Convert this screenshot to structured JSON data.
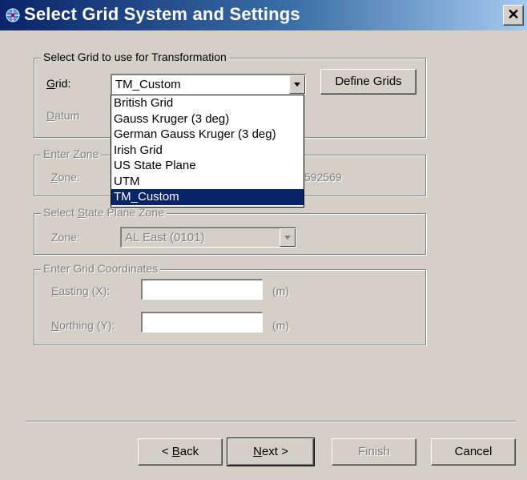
{
  "window": {
    "title": "Select Grid System and Settings",
    "close_glyph": "✕"
  },
  "grid_group": {
    "title": "Select Grid to use for Transformation",
    "grid_label_underline": "G",
    "grid_label_rest": "rid:",
    "grid_value": "TM_Custom",
    "define_grids_label": "Define Grids",
    "datum_label_underline": "D",
    "datum_label_rest": "atum"
  },
  "dropdown": {
    "items": [
      "British Grid",
      "Gauss Kruger (3 deg)",
      "German Gauss Kruger (3 deg)",
      "Irish Grid",
      "US State Plane",
      "UTM",
      "TM_Custom"
    ],
    "selected_index": 6
  },
  "zone_group": {
    "title": "Enter Zone",
    "zone_label_underline": "Z",
    "zone_label_rest": "one:",
    "partial_value": "592569"
  },
  "state_plane_group": {
    "title_prefix": "Select ",
    "title_underline": "S",
    "title_rest": "tate Plane Zone",
    "zone_label": "Zone:",
    "zone_value": "AL East  (0101)"
  },
  "coords_group": {
    "title": "Enter Grid Coordinates",
    "easting_label_underline": "E",
    "easting_label_rest": "asting (X):",
    "northing_label_underline": "N",
    "northing_label_rest": "orthing (Y):",
    "easting_value": "",
    "northing_value": "",
    "unit": "(m)"
  },
  "buttons": {
    "back_prefix": "< ",
    "back_underline": "B",
    "back_rest": "ack",
    "next_underline": "N",
    "next_rest": "ext >",
    "finish": "Finish",
    "cancel": "Cancel"
  },
  "colors": {
    "title_bar_start": "#0a246a",
    "title_bar_end": "#a6caf0",
    "selection": "#0a246a",
    "dialog_face": "#d4d0c8"
  },
  "icons": {
    "title_icon": "globe-grid-icon",
    "close_icon": "close-icon",
    "dropdown_arrow": "chevron-down-icon"
  }
}
